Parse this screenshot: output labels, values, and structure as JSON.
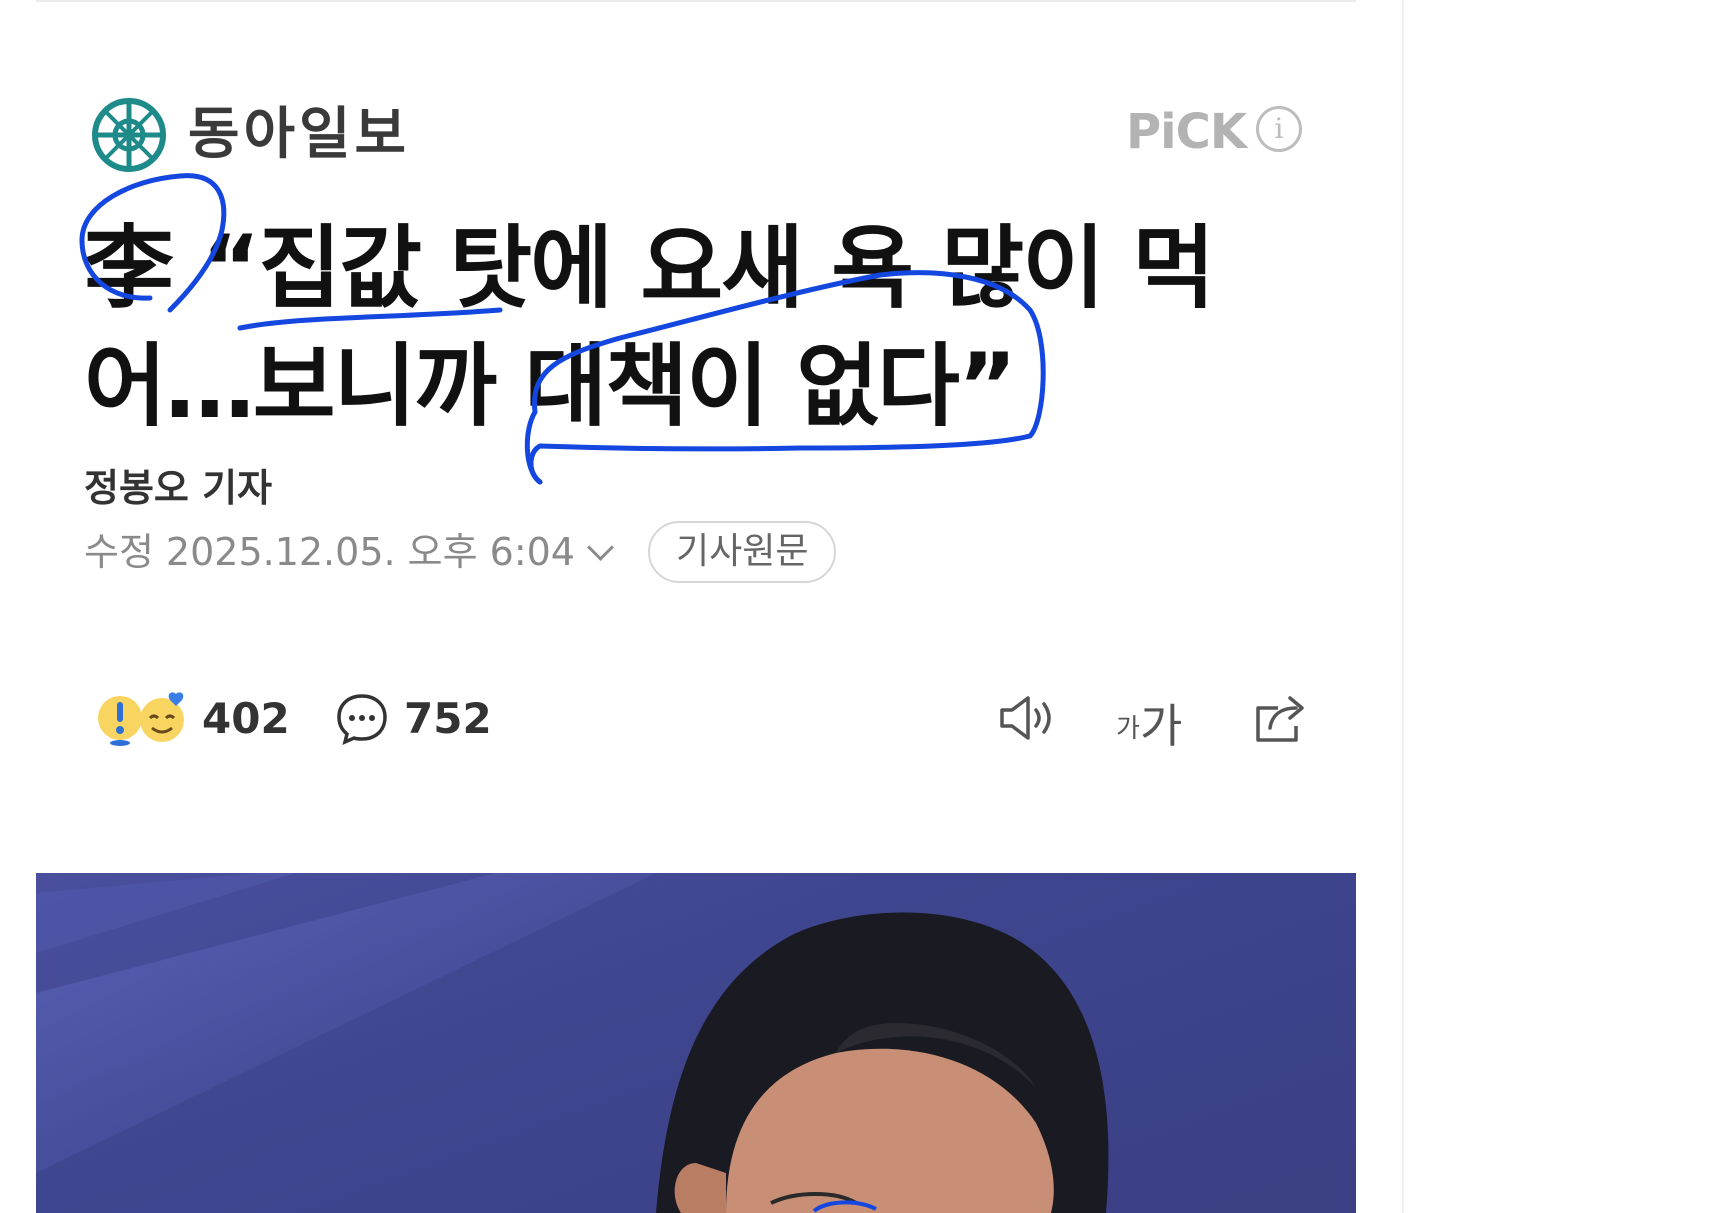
{
  "press": {
    "name": "동아일보",
    "pick_label": "PiCK",
    "info_icon": "info-icon",
    "logo_color": "#1f8a8a"
  },
  "article": {
    "headline_line1": "李 “집값 탓에 요새 욕 많이 먹",
    "headline_line2": "어…보니까 대책이 없다”",
    "reporter": "정봉오 기자",
    "date_label": "수정",
    "date_value": "2025.12.05. 오후 6:04",
    "original_button": "기사원문"
  },
  "actions": {
    "reaction_count": "402",
    "comment_count": "752",
    "tts_icon": "speaker-icon",
    "font_size_label": "가가",
    "share_icon": "share-icon"
  },
  "colors": {
    "annotation": "#1446e0",
    "photo_background": "#4049a0"
  }
}
